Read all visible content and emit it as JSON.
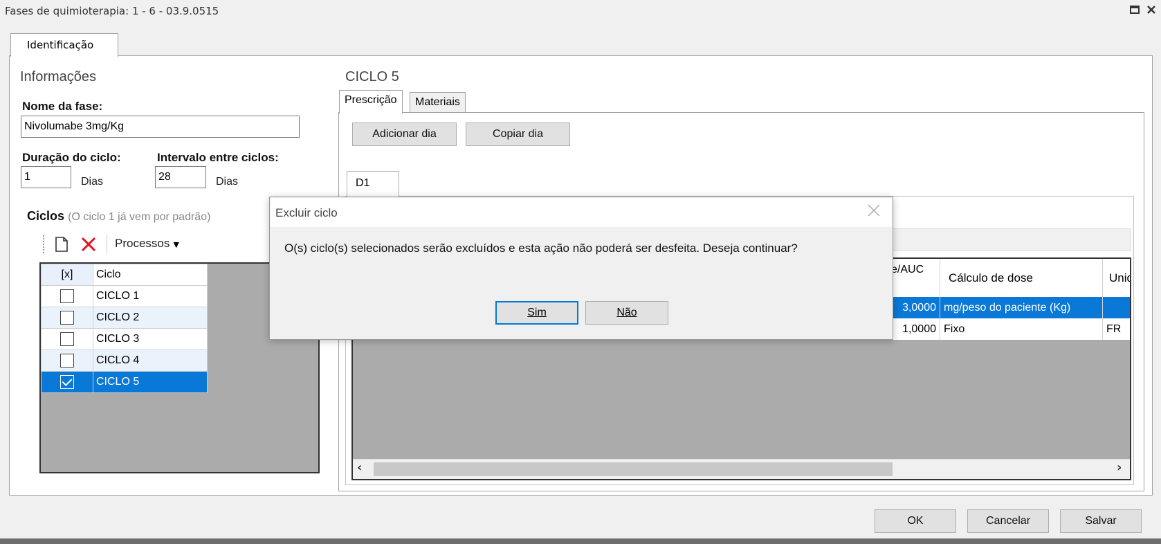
{
  "window": {
    "title": "Fases de quimioterapia: 1 - 6 - 03.9.0515",
    "maximize_glyph": "▫",
    "close_glyph": "✕"
  },
  "main_tab": {
    "label": "Identificação"
  },
  "info": {
    "section_title": "Informações",
    "phase_name_label": "Nome da fase:",
    "phase_name_value": "Nivolumabe 3mg/Kg",
    "cycle_duration_label": "Duração do ciclo:",
    "cycle_duration_value": "1",
    "cycle_duration_unit": "Dias",
    "interval_label": "Intervalo entre ciclos:",
    "interval_value": "28",
    "interval_unit": "Dias"
  },
  "cycles": {
    "title": "Ciclos",
    "note": "(O ciclo 1 já vem por padrão)",
    "toolbar": {
      "new_icon": "new-document-icon",
      "delete_icon": "delete-x-icon",
      "processes_label": "Processos"
    },
    "columns": [
      "[x]",
      "Ciclo"
    ],
    "rows": [
      {
        "checked": false,
        "name": "CICLO 1"
      },
      {
        "checked": false,
        "name": "CICLO 2"
      },
      {
        "checked": false,
        "name": "CICLO 3"
      },
      {
        "checked": false,
        "name": "CICLO 4"
      },
      {
        "checked": true,
        "name": "CICLO 5"
      }
    ]
  },
  "cycle_detail": {
    "title": "CICLO 5",
    "tabs": [
      "Prescrição",
      "Materiais"
    ],
    "add_day_button": "Adicionar dia",
    "copy_day_button": "Copiar dia",
    "day_tab": "D1",
    "grid": {
      "columns": [
        "e/AUC",
        "Cálculo de dose",
        "Unid"
      ],
      "rows": [
        {
          "dose": "3,0000",
          "calc": "mg/peso do paciente (Kg)",
          "unit": "",
          "selected": true
        },
        {
          "dose": "1,0000",
          "calc": "Fixo",
          "unit": "FR",
          "selected": false
        }
      ]
    }
  },
  "dialog": {
    "title": "Excluir ciclo",
    "message": "O(s) ciclo(s) selecionados serão excluídos e esta ação não poderá ser desfeita. Deseja continuar?",
    "yes_label": "Sim",
    "no_label": "Não"
  },
  "footer": {
    "ok_label": "OK",
    "cancel_label": "Cancelar",
    "save_label": "Salvar"
  }
}
